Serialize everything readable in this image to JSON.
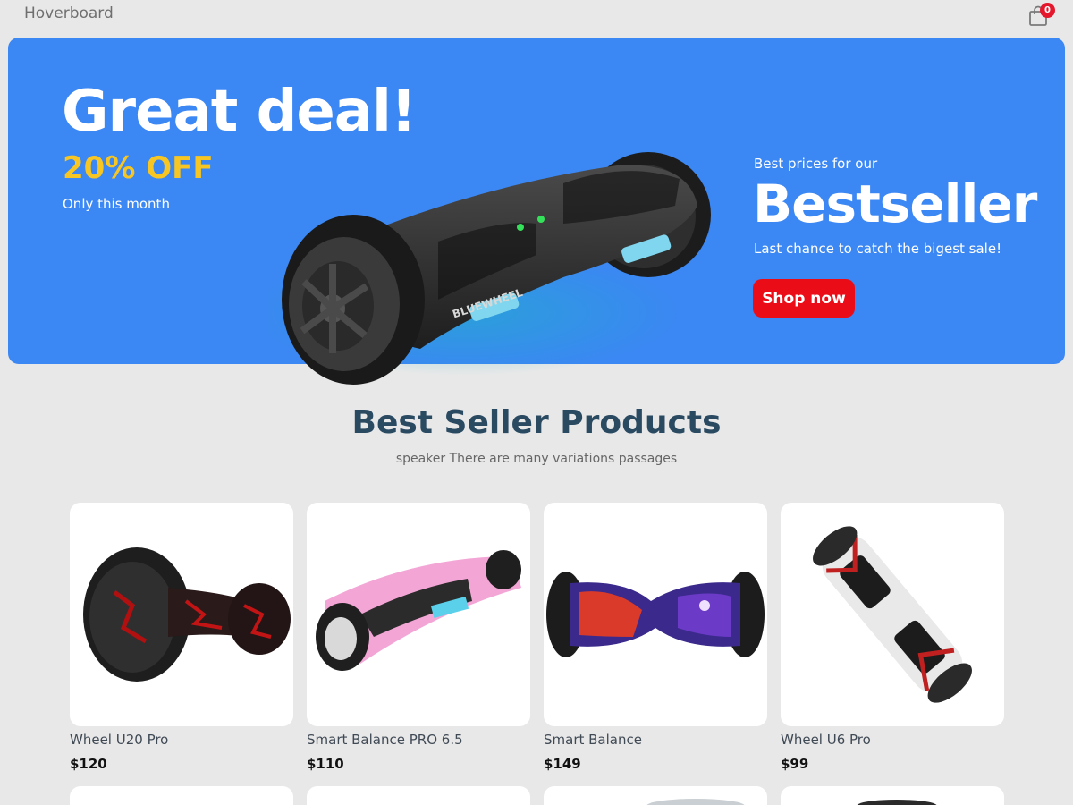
{
  "header": {
    "brand": "Hoverboard",
    "cart_count": "0"
  },
  "hero": {
    "title": "Great deal!",
    "discount": "20% OFF",
    "subtitle": "Only this month",
    "kicker": "Best prices for our",
    "headline": "Bestseller",
    "tagline": "Last chance to catch the bigest sale!",
    "cta_label": "Shop now",
    "board_brand": "BLUEWHEEL"
  },
  "section": {
    "title": "Best Seller Products",
    "subtitle": "speaker There are many variations passages"
  },
  "products": [
    {
      "name": "Wheel U20 Pro",
      "price": "$120"
    },
    {
      "name": "Smart Balance PRO 6.5",
      "price": "$110"
    },
    {
      "name": "Smart Balance",
      "price": "$149"
    },
    {
      "name": "Wheel U6 Pro",
      "price": "$99"
    }
  ],
  "colors": {
    "page_bg": "#e8e8e8",
    "hero_bg": "#3b87f3",
    "accent_yellow": "#f7c623",
    "cta_red": "#ea0d17",
    "heading_navy": "#2a4a62"
  },
  "icons": {
    "cart": "shopping-bag-icon"
  }
}
